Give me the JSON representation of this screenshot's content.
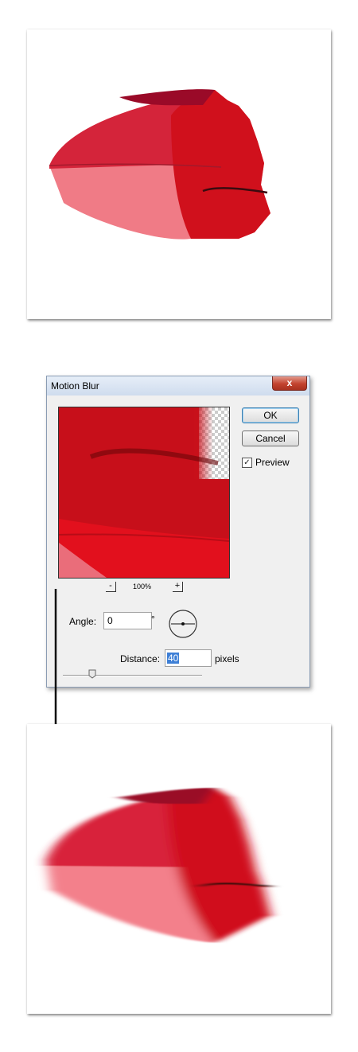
{
  "dialog": {
    "title": "Motion Blur",
    "close_label": "x",
    "ok_label": "OK",
    "cancel_label": "Cancel",
    "preview_label": "Preview",
    "preview_checked": true,
    "zoom_minus": "-",
    "zoom_plus": "+",
    "zoom_level": "100%",
    "angle_label": "Angle:",
    "angle_value": "0",
    "degree_symbol": "°",
    "distance_label": "Distance:",
    "distance_value": "40",
    "distance_unit": "pixels"
  },
  "colors": {
    "umbrella_red": "#d0101c",
    "umbrella_pink": "#f07b86",
    "umbrella_dark": "#9a0a28",
    "dialog_bg": "#f0f0f0",
    "close_red": "#c3432f"
  },
  "icons": [
    "checkbox-check-icon",
    "angle-dial-icon",
    "slider-thumb-icon",
    "down-arrow-icon",
    "close-icon"
  ]
}
